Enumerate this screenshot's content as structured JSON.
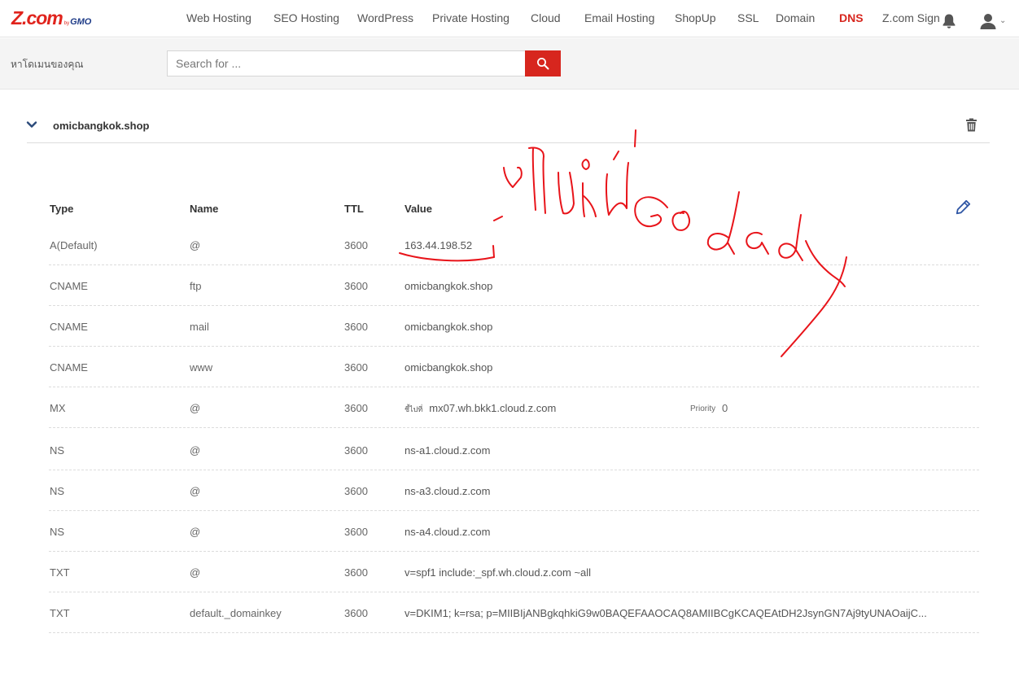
{
  "brand": {
    "main": "Z.com",
    "by": "by",
    "gmo": "GMO"
  },
  "nav": {
    "items": [
      {
        "label": "Web Hosting",
        "active": false
      },
      {
        "label": "SEO Hosting",
        "active": false
      },
      {
        "label": "WordPress",
        "active": false
      },
      {
        "label": "Private Hosting",
        "active": false
      },
      {
        "label": "Cloud",
        "active": false
      },
      {
        "label": "Email Hosting",
        "active": false
      },
      {
        "label": "ShopUp",
        "active": false
      },
      {
        "label": "SSL",
        "active": false
      },
      {
        "label": "Domain",
        "active": false
      },
      {
        "label": "DNS",
        "active": true
      },
      {
        "label": "Z.com Sign",
        "active": false
      }
    ],
    "bell_icon": "bell-icon",
    "user_icon": "user-icon"
  },
  "search": {
    "label": "หาโดเมนของคุณ",
    "placeholder": "Search for ...",
    "button_icon": "search-icon"
  },
  "domain": {
    "name": "omicbangkok.shop",
    "expand_icon": "chevron-down-icon",
    "delete_icon": "trash-icon",
    "edit_icon": "pencil-icon"
  },
  "table": {
    "headers": {
      "type": "Type",
      "name": "Name",
      "ttl": "TTL",
      "value": "Value"
    },
    "rows": [
      {
        "type": "A(Default)",
        "name": "@",
        "ttl": "3600",
        "value": "163.44.198.52"
      },
      {
        "type": "CNAME",
        "name": "ftp",
        "ttl": "3600",
        "value": "omicbangkok.shop"
      },
      {
        "type": "CNAME",
        "name": "mail",
        "ttl": "3600",
        "value": "omicbangkok.shop"
      },
      {
        "type": "CNAME",
        "name": "www",
        "ttl": "3600",
        "value": "omicbangkok.shop"
      },
      {
        "type": "MX",
        "name": "@",
        "ttl": "3600",
        "value_prefix": "ชี้ไปที่",
        "value": "mx07.wh.bkk1.cloud.z.com",
        "priority_label": "Priority",
        "priority": "0"
      },
      {
        "type": "NS",
        "name": "@",
        "ttl": "3600",
        "value": "ns-a1.cloud.z.com"
      },
      {
        "type": "NS",
        "name": "@",
        "ttl": "3600",
        "value": "ns-a3.cloud.z.com"
      },
      {
        "type": "NS",
        "name": "@",
        "ttl": "3600",
        "value": "ns-a4.cloud.z.com"
      },
      {
        "type": "TXT",
        "name": "@",
        "ttl": "3600",
        "value": "v=spf1 include:_spf.wh.cloud.z.com ~all"
      },
      {
        "type": "TXT",
        "name": "default._domainkey",
        "ttl": "3600",
        "value": "v=DKIM1; k=rsa; p=MIIBIjANBgkqhkiG9w0BAQEFAAOCAQ8AMIIBCgKCAQEAtDH2JsynGN7Aj9tyUNAOaijC..."
      }
    ]
  },
  "annotation": {
    "text": "ไปใส่ที่ Go dady",
    "color": "#e8141a"
  },
  "colors": {
    "accent": "#d7261e",
    "header_bg": "#f4f4f4",
    "edit_icon": "#2e55a4"
  }
}
